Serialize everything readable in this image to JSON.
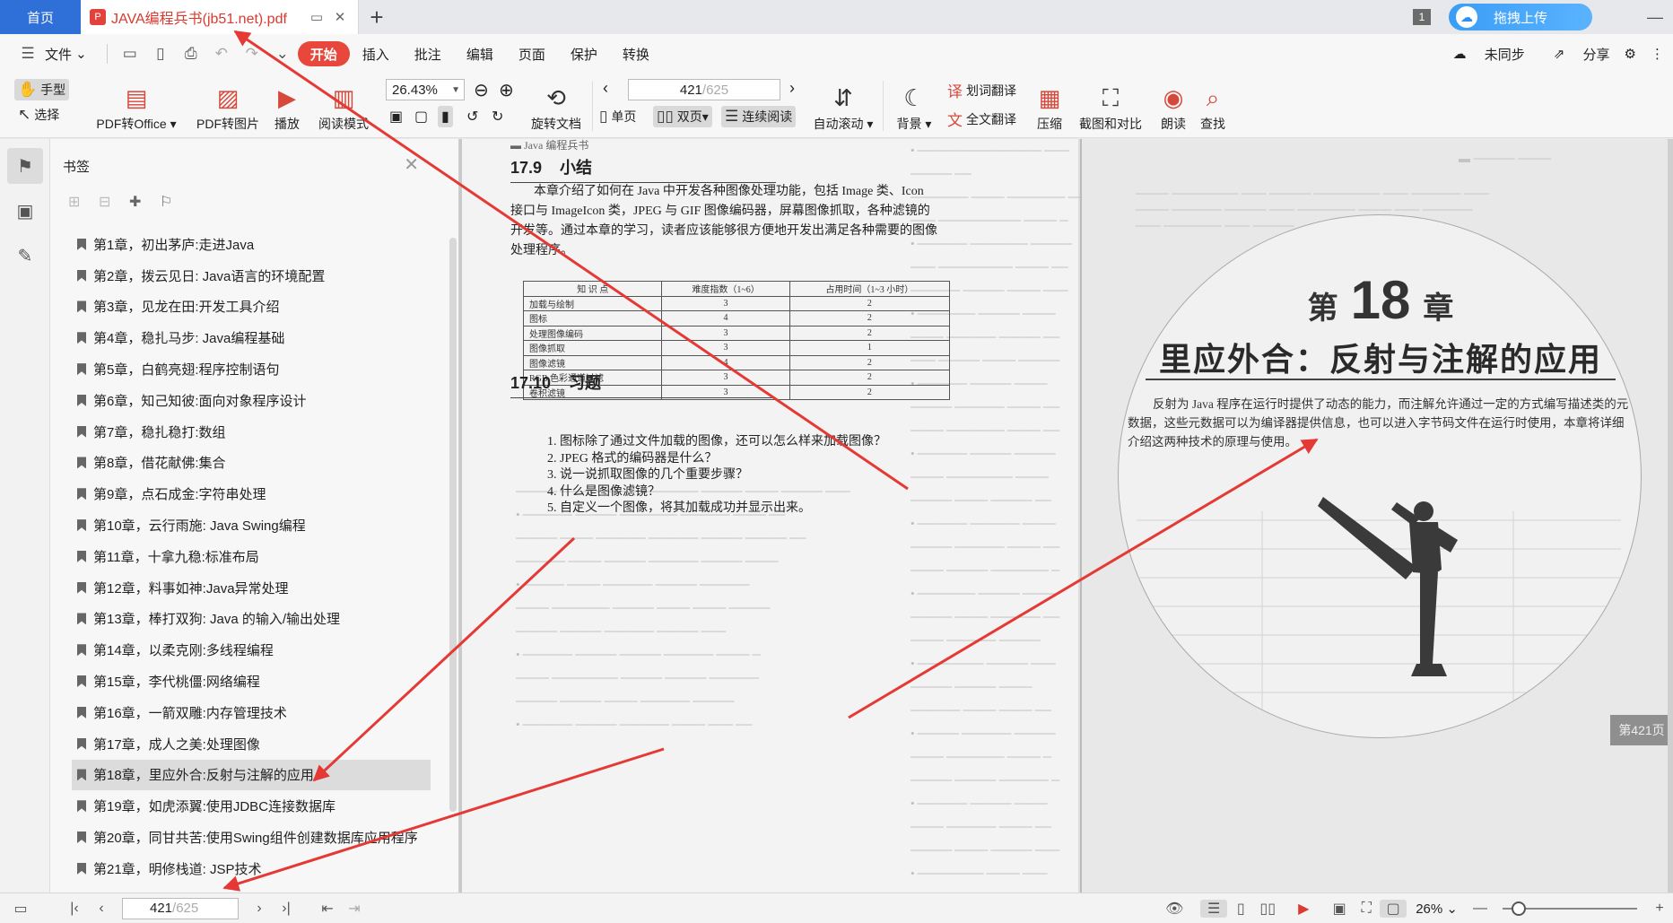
{
  "tabs": {
    "home": "首页",
    "doc_title": "JAVA编程兵书(jb51.net).pdf",
    "pdf_badge": "P",
    "count_badge": "1",
    "upload_label": "拖拽上传"
  },
  "menu": {
    "file": "文件",
    "items": [
      "开始",
      "插入",
      "批注",
      "编辑",
      "页面",
      "保护",
      "转换"
    ],
    "sync": "未同步",
    "share": "分享"
  },
  "ribbon": {
    "hand": "手型",
    "select": "选择",
    "pdf_office": "PDF转Office",
    "pdf_image": "PDF转图片",
    "play": "播放",
    "read_mode": "阅读模式",
    "zoom": "26.43%",
    "rotate": "旋转文档",
    "page_current": "421",
    "page_total": "/625",
    "single": "单页",
    "double": "双页",
    "continuous": "连续阅读",
    "auto_scroll": "自动滚动",
    "background": "背景",
    "word_translate": "划词翻译",
    "full_translate": "全文翻译",
    "compress": "压缩",
    "screenshot": "截图和对比",
    "read_aloud": "朗读",
    "find": "查找"
  },
  "bookmarks": {
    "title": "书签",
    "items": [
      "第1章，初出茅庐:走进Java",
      "第2章，拨云见日: Java语言的环境配置",
      "第3章，见龙在田:开发工具介绍",
      "第4章，稳扎马步: Java编程基础",
      "第5章，白鹤亮翅:程序控制语句",
      "第6章，知己知彼:面向对象程序设计",
      "第7章，稳扎稳打:数组",
      "第8章，借花献佛:集合",
      "第9章，点石成金:字符串处理",
      "第10章，云行雨施: Java Swing编程",
      "第11章，十拿九稳:标准布局",
      "第12章，料事如神:Java异常处理",
      "第13章，棒打双狗: Java 的输入/输出处理",
      "第14章，以柔克刚:多线程编程",
      "第15章，李代桃僵:网络编程",
      "第16章，一箭双雕:内存管理技术",
      "第17章，成人之美:处理图像",
      "第18章，里应外合:反射与注解的应用",
      "第19章，如虎添翼:使用JDBC连接数据库",
      "第20章，同甘共苦:使用Swing组件创建数据库应用程序",
      "第21章，明修栈道: JSP技术"
    ],
    "selected_index": 17
  },
  "left_page": {
    "header_fragment": "Java 编程兵书",
    "sec1_num": "17.9",
    "sec1_title": "小结",
    "summary": "本章介绍了如何在 Java 中开发各种图像处理功能，包括 Image 类、Icon 接口与 ImageIcon 类，JPEG 与 GIF 图像编码器，屏幕图像抓取，各种滤镜的开发等。通过本章的学习，读者应该能够很方便地开发出满足各种需要的图像处理程序。",
    "table_headers": [
      "知 识 点",
      "难度指数（1~6）",
      "占用时间（1~3 小时）"
    ],
    "table_rows": [
      [
        "加载与绘制",
        "3",
        "2"
      ],
      [
        "图标",
        "4",
        "2"
      ],
      [
        "处理图像编码",
        "3",
        "2"
      ],
      [
        "图像抓取",
        "3",
        "1"
      ],
      [
        "图像滤镜",
        "4",
        "2"
      ],
      [
        "RGB 色彩通道过滤",
        "3",
        "2"
      ],
      [
        "卷积滤镜",
        "3",
        "2"
      ]
    ],
    "sec2_num": "17.10",
    "sec2_title": "习题",
    "questions": [
      "1.  图标除了通过文件加载的图像，还可以怎么样来加载图像？",
      "2.  JPEG 格式的编码器是什么？",
      "3.  说一说抓取图像的几个重要步骤？",
      "4.  什么是图像滤镜？",
      "5.  自定义一个图像，将其加载成功并显示出来。"
    ]
  },
  "right_page": {
    "chapter_prefix": "第",
    "chapter_num": "18",
    "chapter_suffix": "章",
    "chapter_title": "里应外合：反射与注解的应用",
    "intro": "反射为 Java 程序在运行时提供了动态的能力，而注解允许通过一定的方式编写描述类的元数据，这些元数据可以为编译器提供信息，也可以进入字节码文件在运行时使用，本章将详细介绍这两种技术的原理与使用。",
    "page_tag": "第421页"
  },
  "statusbar": {
    "page_current": "421",
    "page_total": "/625",
    "zoom": "26%"
  },
  "colors": {
    "accent": "#e8473c",
    "brand_blue": "#2f6fd8",
    "annotation_arrow": "#e53935"
  }
}
